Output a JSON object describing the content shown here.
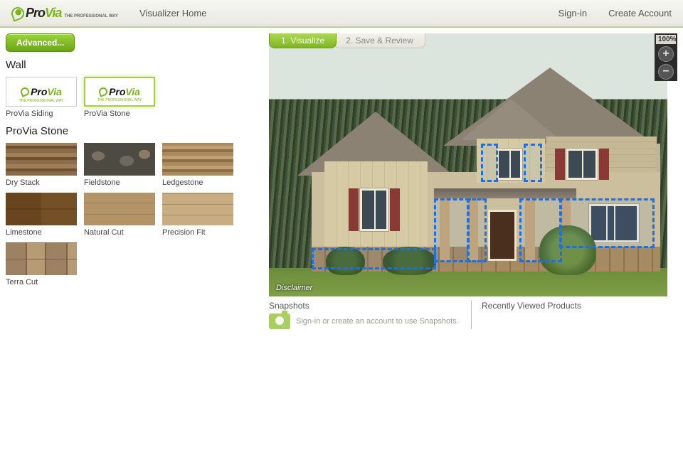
{
  "brand": "ProVia",
  "brand_tagline": "THE PROFESSIONAL WAY",
  "nav": {
    "home": "Visualizer Home"
  },
  "header": {
    "signin": "Sign-in",
    "create": "Create Account"
  },
  "advanced_btn": "Advanced...",
  "wall_title": "Wall",
  "brands": [
    {
      "label": "ProVia Siding",
      "selected": false
    },
    {
      "label": "ProVia Stone",
      "selected": true
    }
  ],
  "category_title": "ProVia Stone",
  "stones": [
    {
      "label": "Dry Stack",
      "tex": "tex-drystack"
    },
    {
      "label": "Fieldstone",
      "tex": "tex-fieldstone"
    },
    {
      "label": "Ledgestone",
      "tex": "tex-ledgestone"
    },
    {
      "label": "Limestone",
      "tex": "tex-limestone"
    },
    {
      "label": "Natural Cut",
      "tex": "tex-naturalcut"
    },
    {
      "label": "Precision Fit",
      "tex": "tex-precisionfit"
    },
    {
      "label": "Terra Cut",
      "tex": "tex-terracut"
    }
  ],
  "tabs": {
    "visualize": "1. Visualize",
    "save": "2. Save & Review"
  },
  "zoom": {
    "pct": "100%",
    "in": "+",
    "out": "−"
  },
  "disclaimer": "Disclaimer",
  "snapshots": {
    "title": "Snapshots",
    "msg": "Sign-in or create an account to use Snapshots."
  },
  "recent": {
    "title": "Recently Viewed Products"
  }
}
